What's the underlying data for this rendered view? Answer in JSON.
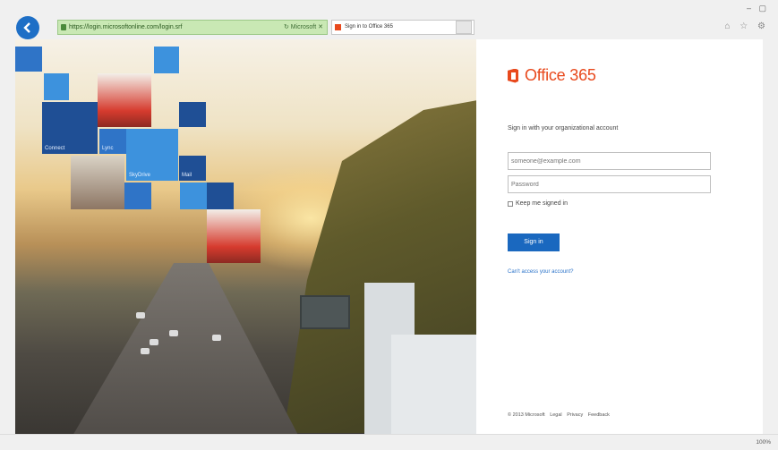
{
  "browser": {
    "address": "https://login.microsoftonline.com/login.srf",
    "address_tools": "↻  Microsoft  ✕",
    "tab_title": "Sign in to Office 365",
    "tab_close": "✕",
    "window_controls": "–  ▢",
    "nav_icons": "⌂ ☆ ⚙",
    "zoom": "100%"
  },
  "hero": {
    "tiles": {
      "connect": "Connect",
      "lync": "Lync",
      "skydrive": "SkyDrive",
      "mail": "Mail"
    }
  },
  "signin": {
    "brand": "Office 365",
    "prompt": "Sign in with your organizational account",
    "username_placeholder": "someone@example.com",
    "password_placeholder": "Password",
    "keep_signed_in": "Keep me signed in",
    "button": "Sign in",
    "cant_access": "Can't access your account?"
  },
  "footer": {
    "copyright": "© 2013 Microsoft",
    "legal": "Legal",
    "privacy": "Privacy",
    "feedback": "Feedback"
  },
  "colors": {
    "accent": "#1a68bf",
    "brand": "#e8491d"
  }
}
